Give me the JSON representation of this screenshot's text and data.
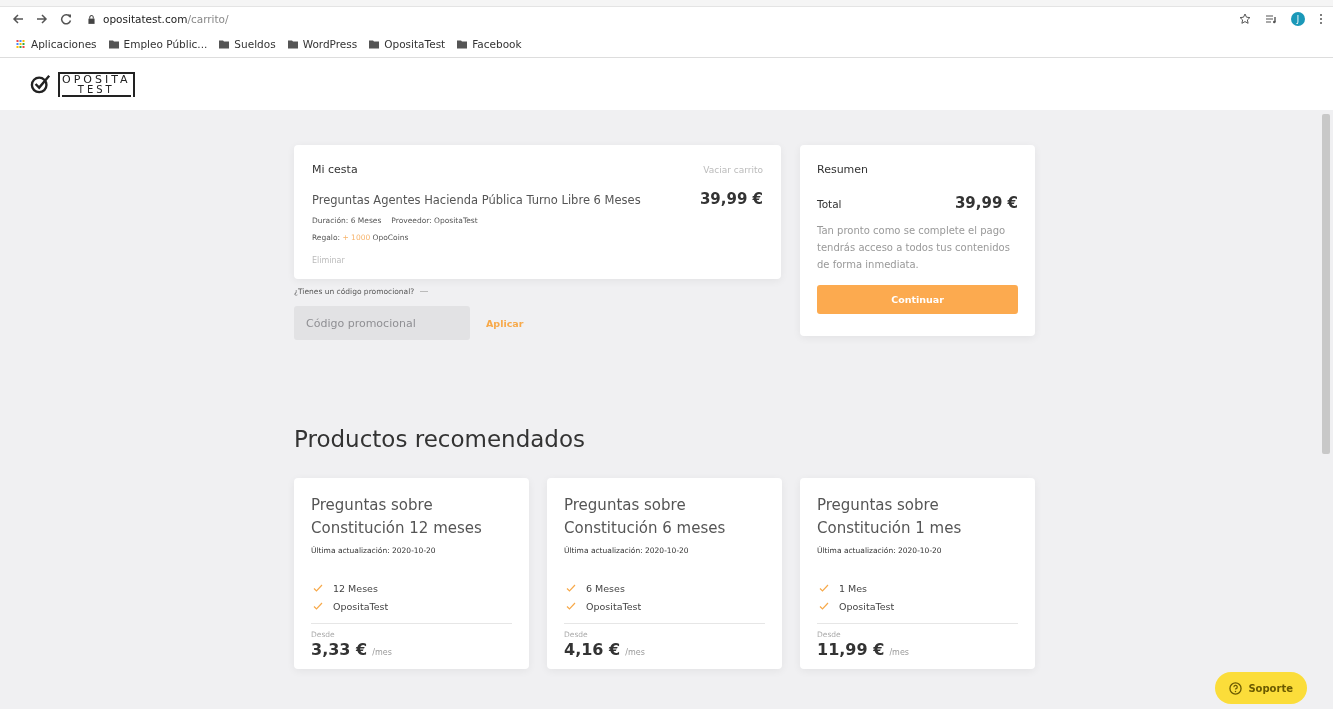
{
  "browser": {
    "url_host": "opositatest.com",
    "url_path": "/carrito/",
    "avatar_letter": "J",
    "bookmarks": [
      {
        "label": "Aplicaciones",
        "kind": "apps"
      },
      {
        "label": "Empleo Públic...",
        "kind": "folder"
      },
      {
        "label": "Sueldos",
        "kind": "folder"
      },
      {
        "label": "WordPress",
        "kind": "folder"
      },
      {
        "label": "OpositaTest",
        "kind": "folder"
      },
      {
        "label": "Facebook",
        "kind": "folder"
      }
    ]
  },
  "logo": {
    "top": "OPOSITA",
    "bottom": "TEST"
  },
  "cart": {
    "title": "Mi cesta",
    "clear_link": "Vaciar carrito",
    "item": {
      "name": "Preguntas Agentes Hacienda Pública Turno Libre 6 Meses",
      "price": "39,99 €",
      "duration": "Duración: 6 Meses",
      "provider": "Proveedor: OpositaTest",
      "gift_label": "Regalo:",
      "gift_amount": "+ 1000",
      "gift_unit": "OpoCoins",
      "remove": "Eliminar"
    }
  },
  "promo": {
    "question": "¿Tienes un código promocional?",
    "placeholder": "Código promocional",
    "apply": "Aplicar"
  },
  "summary": {
    "title": "Resumen",
    "total_label": "Total",
    "total": "39,99 €",
    "note": "Tan pronto como se complete el pago tendrás acceso a todos tus contenidos de forma inmediata.",
    "button": "Continuar"
  },
  "recommended": {
    "title": "Productos recomendados",
    "products": [
      {
        "title": "Preguntas sobre Constitución 12 meses",
        "updated": "Última actualización: 2020-10-20",
        "features": [
          "12 Meses",
          "OpositaTest"
        ],
        "from_label": "Desde",
        "price": "3,33 €",
        "unit": "/mes"
      },
      {
        "title": "Preguntas sobre Constitución 6 meses",
        "updated": "Última actualización: 2020-10-20",
        "features": [
          "6 Meses",
          "OpositaTest"
        ],
        "from_label": "Desde",
        "price": "4,16 €",
        "unit": "/mes"
      },
      {
        "title": "Preguntas sobre Constitución 1 mes",
        "updated": "Última actualización: 2020-10-20",
        "features": [
          "1 Mes",
          "OpositaTest"
        ],
        "from_label": "Desde",
        "price": "11,99 €",
        "unit": "/mes"
      }
    ]
  },
  "support": {
    "label": "Soporte"
  }
}
